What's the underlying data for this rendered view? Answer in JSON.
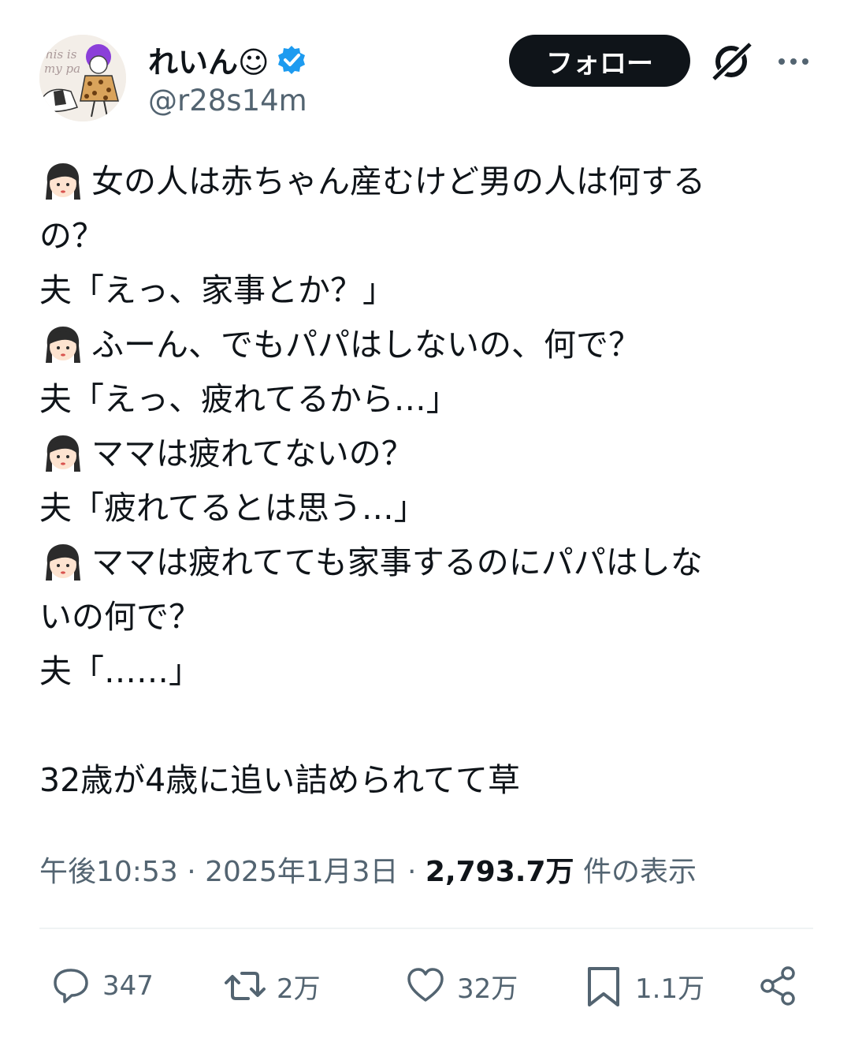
{
  "author": {
    "display_name": "れいん☺",
    "handle": "@r28s14m",
    "verified": true,
    "avatar_icon": "avatar-illustration"
  },
  "header": {
    "follow_label": "フォロー",
    "grok_icon": "grok-icon",
    "more_icon": "more-icon"
  },
  "post": {
    "lines": [
      {
        "icon": true,
        "text": "女の人は赤ちゃん産むけど男の人は何する"
      },
      {
        "icon": false,
        "text": "の？"
      },
      {
        "icon": false,
        "text": "夫「えっ、家事とか？」"
      },
      {
        "icon": true,
        "text": "ふーん、でもパパはしないの、何で？"
      },
      {
        "icon": false,
        "text": "夫「えっ、疲れてるから…」"
      },
      {
        "icon": true,
        "text": "ママは疲れてないの？"
      },
      {
        "icon": false,
        "text": "夫「疲れてるとは思う…」"
      },
      {
        "icon": true,
        "text": "ママは疲れてても家事するのにパパはしな"
      },
      {
        "icon": false,
        "text": "いの何で？"
      },
      {
        "icon": false,
        "text": "夫「……」"
      },
      {
        "icon": false,
        "text": ""
      },
      {
        "icon": false,
        "text": "32歳が4歳に追い詰められてて草"
      }
    ]
  },
  "meta": {
    "time": "午後10:53",
    "sep": "·",
    "date": "2025年1月3日",
    "views": "2,793.7万",
    "views_label": "件の表示"
  },
  "actions": {
    "replies": "347",
    "reposts": "2万",
    "likes": "32万",
    "bookmarks": "1.1万"
  },
  "colors": {
    "text": "#0f1419",
    "secondary": "#536471",
    "verified": "#1d9bf0",
    "follow_bg": "#0f1419"
  }
}
